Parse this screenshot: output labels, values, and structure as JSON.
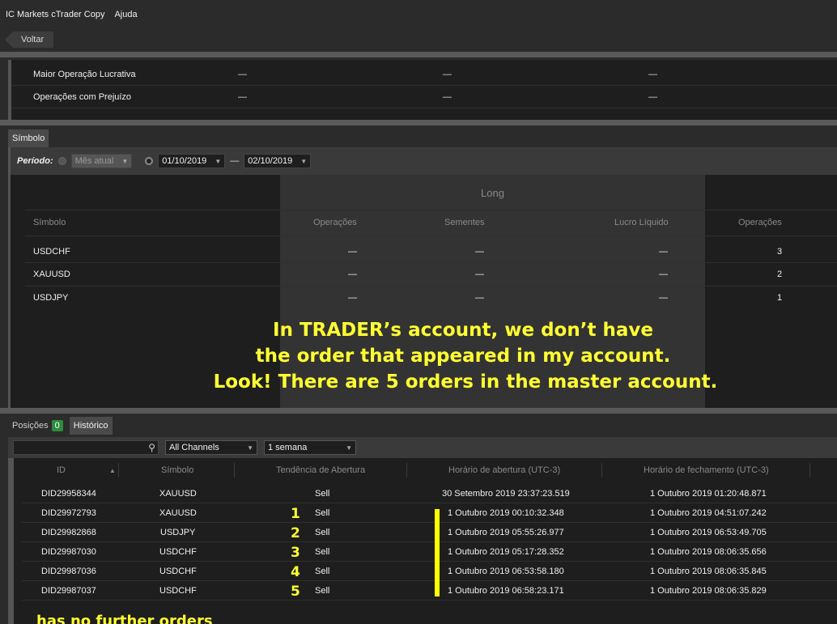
{
  "menubar": {
    "app_title": "IC Markets cTrader Copy",
    "help": "Ajuda"
  },
  "nav": {
    "back_label": "Voltar"
  },
  "stats": {
    "rows": [
      {
        "label": "Maior Operação Lucrativa",
        "values": [
          "—",
          "—",
          "—"
        ]
      },
      {
        "label": "Operações com Prejuízo",
        "values": [
          "—",
          "—",
          "—"
        ]
      }
    ]
  },
  "symbol_tab": {
    "label": "Símbolo"
  },
  "period": {
    "label": "Período:",
    "preset": "Mês atual",
    "from": "01/10/2019",
    "separator": "—",
    "to": "02/10/2019"
  },
  "symbol_table": {
    "group_header": "Long",
    "columns": [
      "Símbolo",
      "Operações",
      "Sementes",
      "Lucro Líquido",
      "Operações"
    ],
    "rows": [
      {
        "symbol": "USDCHF",
        "ops": "—",
        "seeds": "—",
        "profit": "—",
        "ops2": "3"
      },
      {
        "symbol": "XAUUSD",
        "ops": "—",
        "seeds": "—",
        "profit": "—",
        "ops2": "2"
      },
      {
        "symbol": "USDJPY",
        "ops": "—",
        "seeds": "—",
        "profit": "—",
        "ops2": "1"
      }
    ]
  },
  "annotation": {
    "line1": "In TRADER’s account, we don’t have",
    "line2": "the order that appeared in my account.",
    "line3": "Look! There are 5 orders in the master account.",
    "numbers": [
      "1",
      "2",
      "3",
      "4",
      "5"
    ],
    "bottom": "has no further orders"
  },
  "bottom_tabs": {
    "positions_label": "Posições",
    "positions_count": "0",
    "history_label": "Histórico"
  },
  "history_filters": {
    "search_value": "",
    "channel": "All Channels",
    "range": "1 semana"
  },
  "history_table": {
    "columns": [
      "ID",
      "Símbolo",
      "Tendência de Abertura",
      "Horário de abertura (UTC-3)",
      "Horário de fechamento (UTC-3)"
    ],
    "sort_indicator": "▲",
    "rows": [
      {
        "id": "DID29958344",
        "symbol": "XAUUSD",
        "side": "Sell",
        "open": "30 Setembro 2019 23:37:23.519",
        "close": "1 Outubro 2019 01:20:48.871"
      },
      {
        "id": "DID29972793",
        "symbol": "XAUUSD",
        "side": "Sell",
        "open": "1 Outubro 2019 00:10:32.348",
        "close": "1 Outubro 2019 04:51:07.242"
      },
      {
        "id": "DID29982868",
        "symbol": "USDJPY",
        "side": "Sell",
        "open": "1 Outubro 2019 05:55:26.977",
        "close": "1 Outubro 2019 06:53:49.705"
      },
      {
        "id": "DID29987030",
        "symbol": "USDCHF",
        "side": "Sell",
        "open": "1 Outubro 2019 05:17:28.352",
        "close": "1 Outubro 2019 08:06:35.656"
      },
      {
        "id": "DID29987036",
        "symbol": "USDCHF",
        "side": "Sell",
        "open": "1 Outubro 2019 06:53:58.180",
        "close": "1 Outubro 2019 08:06:35.845"
      },
      {
        "id": "DID29987037",
        "symbol": "USDCHF",
        "side": "Sell",
        "open": "1 Outubro 2019 06:58:23.171",
        "close": "1 Outubro 2019 08:06:35.829"
      }
    ]
  },
  "colors": {
    "annotation": "#ffff33",
    "badge": "#2e8b3e",
    "panel": "#1e1e1e"
  }
}
